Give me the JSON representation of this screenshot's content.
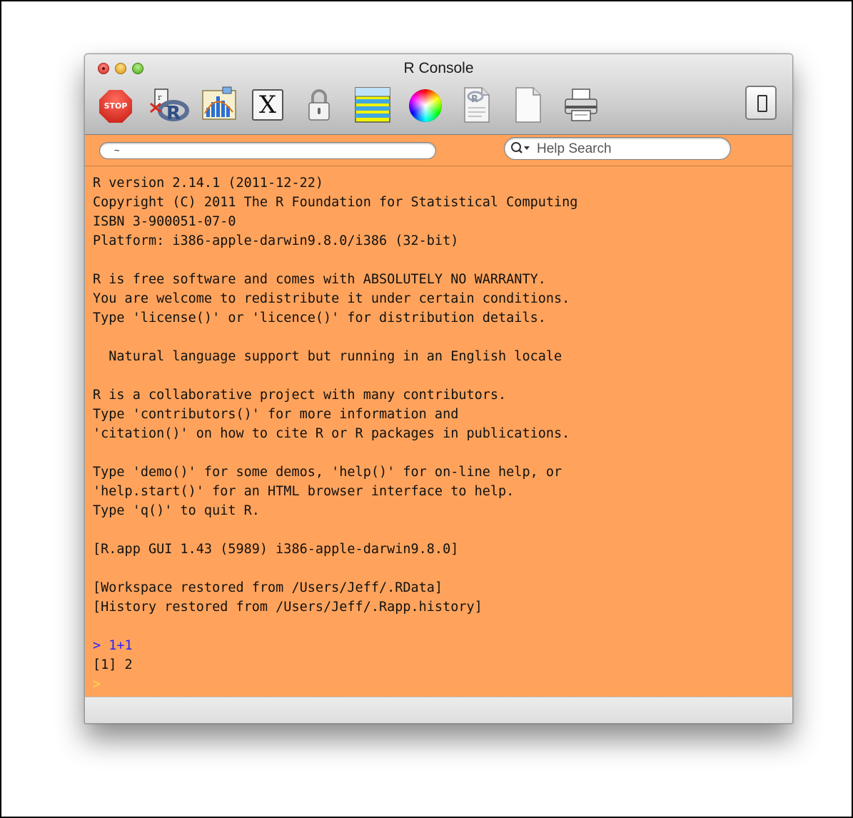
{
  "window": {
    "title": "R Console"
  },
  "toolbar": {
    "stop_label": "STOP",
    "x11_label": "X"
  },
  "path_field": {
    "value": "~"
  },
  "help_search": {
    "placeholder": "Help Search"
  },
  "console": {
    "lines": [
      {
        "text": "R version 2.14.1 (2011-12-22)",
        "kind": "output"
      },
      {
        "text": "Copyright (C) 2011 The R Foundation for Statistical Computing",
        "kind": "output"
      },
      {
        "text": "ISBN 3-900051-07-0",
        "kind": "output"
      },
      {
        "text": "Platform: i386-apple-darwin9.8.0/i386 (32-bit)",
        "kind": "output"
      },
      {
        "text": "",
        "kind": "output"
      },
      {
        "text": "R is free software and comes with ABSOLUTELY NO WARRANTY.",
        "kind": "output"
      },
      {
        "text": "You are welcome to redistribute it under certain conditions.",
        "kind": "output"
      },
      {
        "text": "Type 'license()' or 'licence()' for distribution details.",
        "kind": "output"
      },
      {
        "text": "",
        "kind": "output"
      },
      {
        "text": "  Natural language support but running in an English locale",
        "kind": "output"
      },
      {
        "text": "",
        "kind": "output"
      },
      {
        "text": "R is a collaborative project with many contributors.",
        "kind": "output"
      },
      {
        "text": "Type 'contributors()' for more information and",
        "kind": "output"
      },
      {
        "text": "'citation()' on how to cite R or R packages in publications.",
        "kind": "output"
      },
      {
        "text": "",
        "kind": "output"
      },
      {
        "text": "Type 'demo()' for some demos, 'help()' for on-line help, or",
        "kind": "output"
      },
      {
        "text": "'help.start()' for an HTML browser interface to help.",
        "kind": "output"
      },
      {
        "text": "Type 'q()' to quit R.",
        "kind": "output"
      },
      {
        "text": "",
        "kind": "output"
      },
      {
        "text": "[R.app GUI 1.43 (5989) i386-apple-darwin9.8.0]",
        "kind": "output"
      },
      {
        "text": "",
        "kind": "output"
      },
      {
        "text": "[Workspace restored from /Users/Jeff/.RData]",
        "kind": "output"
      },
      {
        "text": "[History restored from /Users/Jeff/.Rapp.history]",
        "kind": "output"
      },
      {
        "text": "",
        "kind": "output"
      },
      {
        "text": "> 1+1",
        "kind": "input"
      },
      {
        "text": "[1] 2",
        "kind": "output"
      },
      {
        "text": ">",
        "kind": "prompt"
      }
    ]
  },
  "colors": {
    "console_background": "#ffa35c",
    "input_text": "#2323ff",
    "prompt": "#ffd94a",
    "output_text": "#111111"
  }
}
